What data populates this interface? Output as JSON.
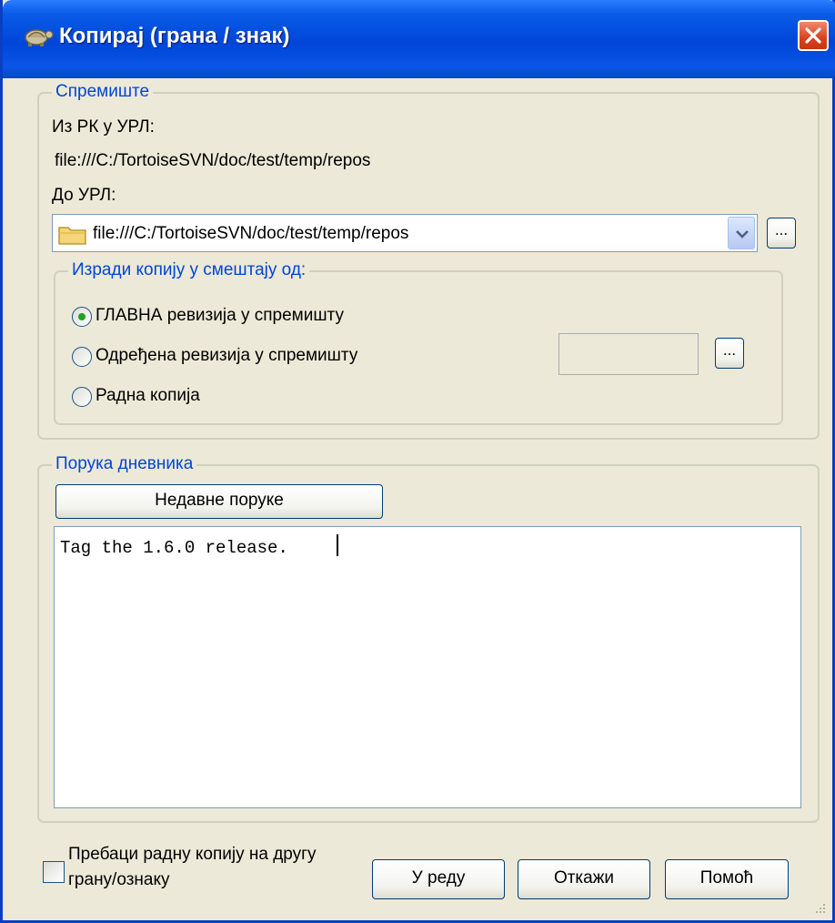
{
  "window": {
    "title": "Копирај (грана / знак)",
    "title_icon": "tortoise-icon",
    "close_icon": "close-icon"
  },
  "repository": {
    "legend": "Спремиште",
    "from_label": "Из РК у УРЛ:",
    "from_url": "file:///C:/TortoiseSVN/doc/test/temp/repos",
    "to_label": "До УРЛ:",
    "to_url": "file:///C:/TortoiseSVN/doc/test/temp/repos",
    "browse_label": "...",
    "copy_group": {
      "legend": "Изради копију у смештају од:",
      "options": [
        {
          "label": "ГЛАВНА ревизија у спремишту",
          "selected": true
        },
        {
          "label": "Одређена ревизија у спремишту",
          "selected": false
        },
        {
          "label": "Радна копија",
          "selected": false
        }
      ],
      "revision_value": "",
      "revision_browse_label": "..."
    }
  },
  "log": {
    "legend": "Порука дневника",
    "recent_button": "Недавне поруке",
    "message": "Tag the 1.6.0 release."
  },
  "switch_checkbox": {
    "label_line1": "Пребаци радну копију на другу",
    "label_line2": "грану/ознаку",
    "checked": false
  },
  "buttons": {
    "ok": "У реду",
    "cancel": "Откажи",
    "help": "Помоћ"
  },
  "colors": {
    "titlebar": "#0046d8",
    "group_legend": "#0046d5",
    "dialog_bg": "#ece9d8",
    "radio_dot": "#21a121"
  }
}
